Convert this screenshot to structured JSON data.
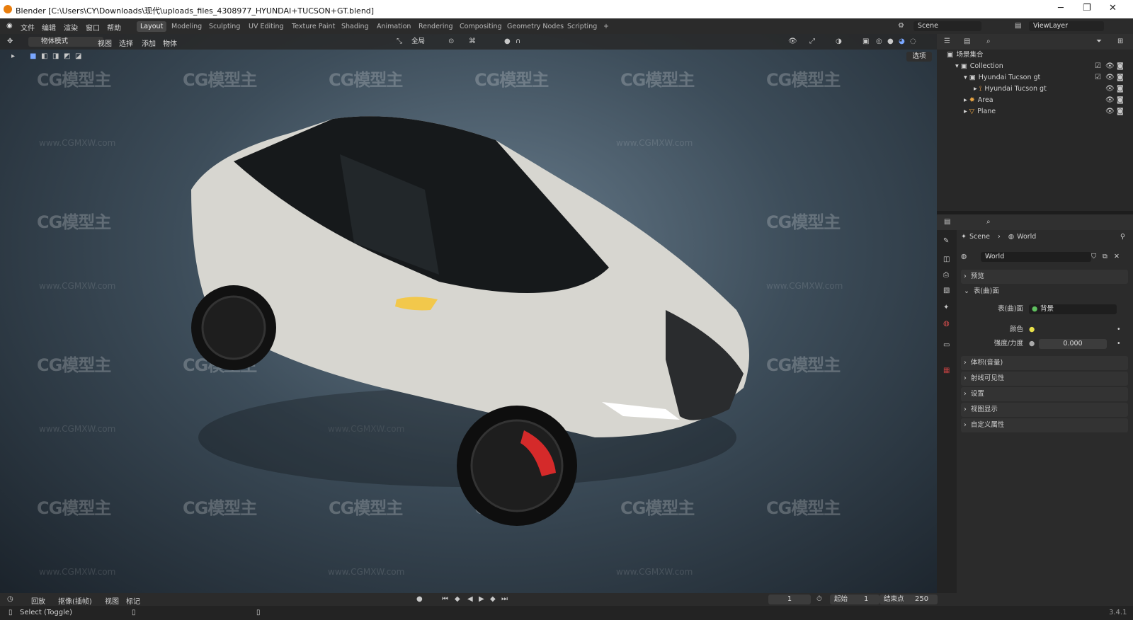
{
  "window": {
    "title": "Blender [C:\\Users\\CY\\Downloads\\现代\\uploads_files_4308977_HYUNDAI+TUCSON+GT.blend]"
  },
  "menu": [
    "文件",
    "编辑",
    "渲染",
    "窗口",
    "帮助"
  ],
  "workspaces": [
    {
      "label": "Layout",
      "active": true
    },
    {
      "label": "Modeling"
    },
    {
      "label": "Sculpting"
    },
    {
      "label": "UV Editing"
    },
    {
      "label": "Texture Paint"
    },
    {
      "label": "Shading"
    },
    {
      "label": "Animation"
    },
    {
      "label": "Rendering"
    },
    {
      "label": "Compositing"
    },
    {
      "label": "Geometry Nodes"
    },
    {
      "label": "Scripting"
    }
  ],
  "scene_selector": "Scene",
  "viewlayer_selector": "ViewLayer",
  "viewport": {
    "mode": "物体模式",
    "menus": [
      "视图",
      "选择",
      "添加",
      "物体"
    ],
    "transform_orientation": "全局",
    "options_label": "选项",
    "watermark_logo": "CG模型主",
    "watermark_url": "www.CGMXW.com"
  },
  "outliner": {
    "root": "场景集合",
    "rows": [
      {
        "label": "Collection",
        "indent": 1
      },
      {
        "label": "Hyundai Tucson gt",
        "indent": 2
      },
      {
        "label": "Hyundai Tucson gt",
        "indent": 3
      },
      {
        "label": "Area",
        "indent": 2
      },
      {
        "label": "Plane",
        "indent": 2
      }
    ]
  },
  "properties": {
    "breadcrumb": [
      "Scene",
      "World"
    ],
    "world_name": "World",
    "panels": {
      "preview": "预览",
      "surface": "表(曲)面",
      "surface_label": "表(曲)面",
      "surface_value": "背景",
      "color_label": "颜色",
      "strength_label": "强度/力度",
      "strength_value": "0.000",
      "volume": "体积(音量)",
      "ray_visibility": "射线可见性",
      "settings": "设置",
      "viewport_display": "视图显示",
      "custom_props": "自定义属性"
    }
  },
  "timeline": {
    "menus": [
      "回放",
      "抠像(插帧)",
      "视图",
      "标记"
    ],
    "current_frame": "1",
    "start_label": "起始",
    "start_value": "1",
    "end_label": "结束点",
    "end_value": "250"
  },
  "status": {
    "hint": "Select (Toggle)",
    "version": "3.4.1"
  }
}
